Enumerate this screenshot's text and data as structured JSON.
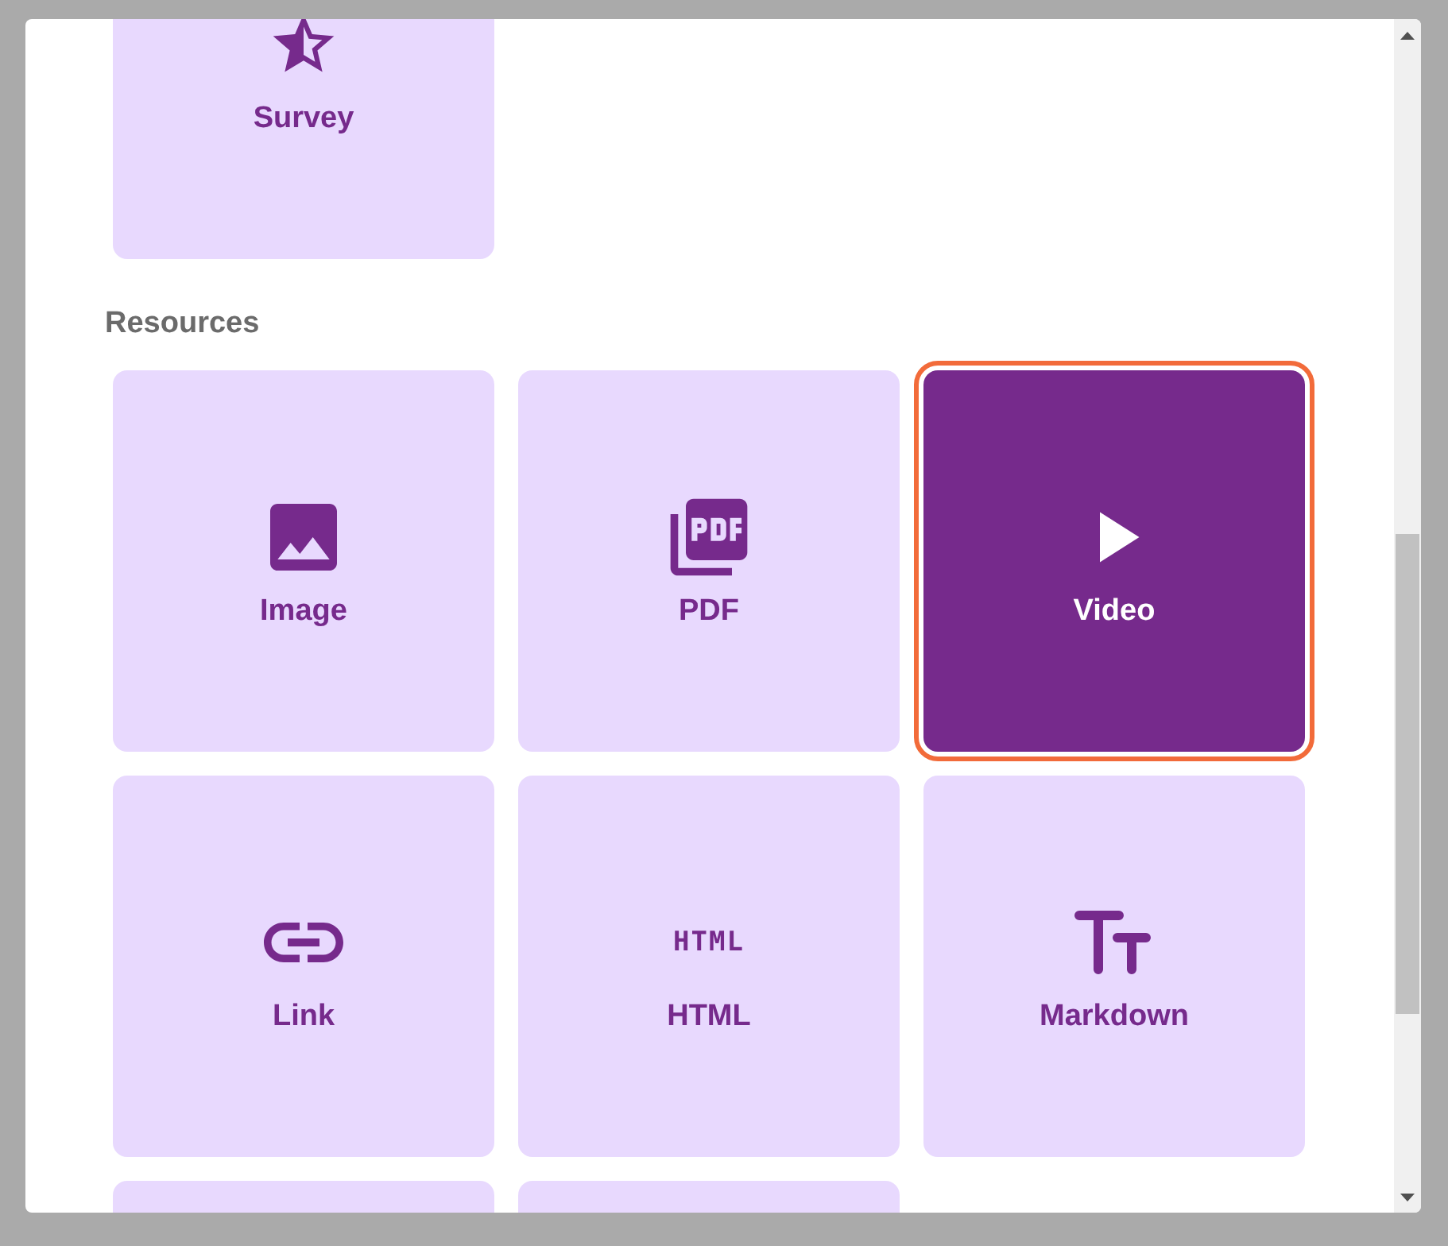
{
  "sections": [
    {
      "items": [
        {
          "kind": "survey",
          "label": "Survey",
          "selected": false
        }
      ]
    },
    {
      "heading": "Resources",
      "items": [
        {
          "kind": "image",
          "label": "Image",
          "selected": false
        },
        {
          "kind": "pdf",
          "label": "PDF",
          "selected": false
        },
        {
          "kind": "video",
          "label": "Video",
          "selected": true
        },
        {
          "kind": "link",
          "label": "Link",
          "selected": false
        },
        {
          "kind": "html",
          "icon_text": "HTML",
          "label": "HTML",
          "selected": false
        },
        {
          "kind": "markdown",
          "label": "Markdown",
          "selected": false
        },
        {
          "kind": "partial",
          "selected": false
        },
        {
          "kind": "partial",
          "selected": false
        }
      ]
    }
  ]
}
